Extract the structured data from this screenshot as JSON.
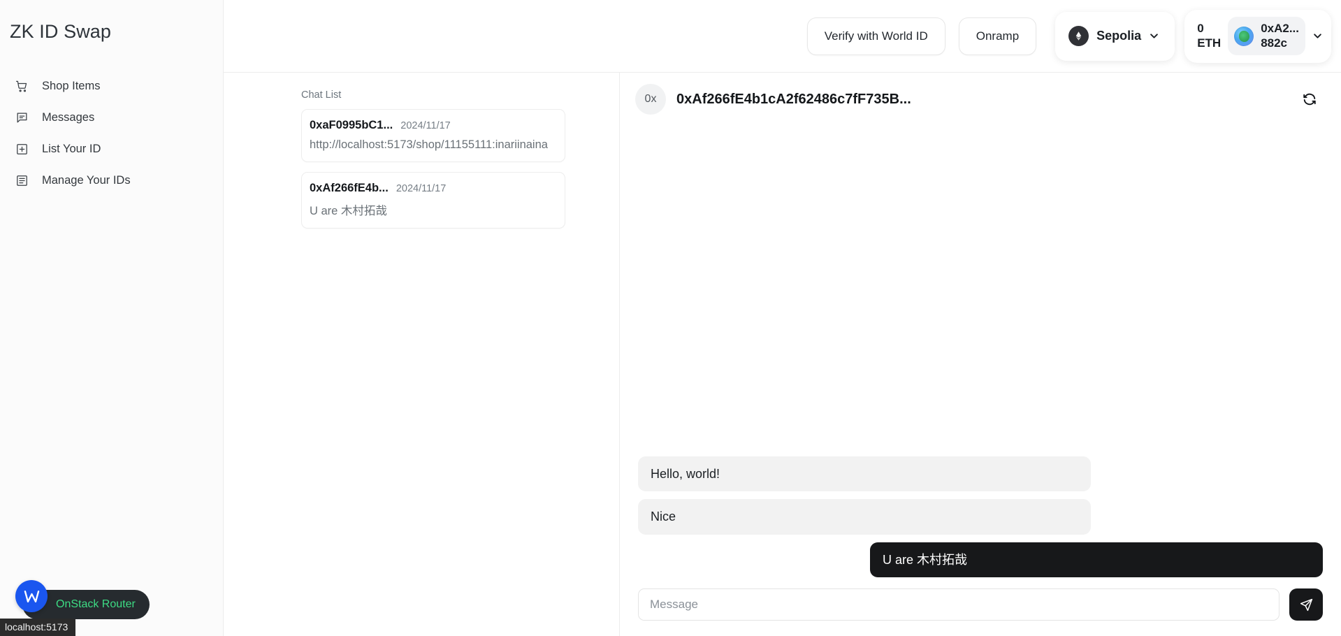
{
  "sidebar": {
    "brand": "ZK ID Swap",
    "items": [
      {
        "label": "Shop Items",
        "icon": "shopping-cart-icon"
      },
      {
        "label": "Messages",
        "icon": "chat-bubble-icon"
      },
      {
        "label": "List Your ID",
        "icon": "plus-square-icon"
      },
      {
        "label": "Manage Your IDs",
        "icon": "list-document-icon"
      }
    ]
  },
  "topbar": {
    "verify_label": "Verify with World ID",
    "onramp_label": "Onramp",
    "network": {
      "name": "Sepolia",
      "icon": "ethereum-icon",
      "chevron": "chevron-down-icon"
    },
    "wallet": {
      "balance": "0\nETH",
      "address_line1": "0xA2...",
      "address_line2": "882c",
      "address": "0xA2...882c",
      "chevron": "chevron-down-icon",
      "avatar": "wallet-avatar-blob"
    }
  },
  "chat_list": {
    "title": "Chat List",
    "items": [
      {
        "peer": "0xaF0995bC1...",
        "date": "2024/11/17",
        "preview": "http://localhost:5173/shop/11155111:inariinaina"
      },
      {
        "peer": "0xAf266fE4b...",
        "date": "2024/11/17",
        "preview": "U are 木村拓哉"
      }
    ]
  },
  "conversation": {
    "avatar_label": "0x",
    "peer_address": "0xAf266fE4b1cA2f62486c7fF735B...",
    "refresh_icon": "refresh-icon",
    "messages": [
      {
        "text": "Hello, world!",
        "direction": "in"
      },
      {
        "text": "Nice",
        "direction": "in"
      },
      {
        "text": "U are 木村拓哉",
        "direction": "out"
      }
    ],
    "composer": {
      "placeholder": "Message",
      "value": "",
      "send_icon": "send-paper-plane-icon"
    }
  },
  "overlays": {
    "router_badge": "OnStack Router",
    "router_logo": "w-logo-icon",
    "status_url": "localhost:5173"
  },
  "colors": {
    "accent_dark": "#17181a",
    "router_green": "#3ddc84",
    "router_blue": "#1a56ef",
    "bubble_in": "#f2f2f2"
  }
}
